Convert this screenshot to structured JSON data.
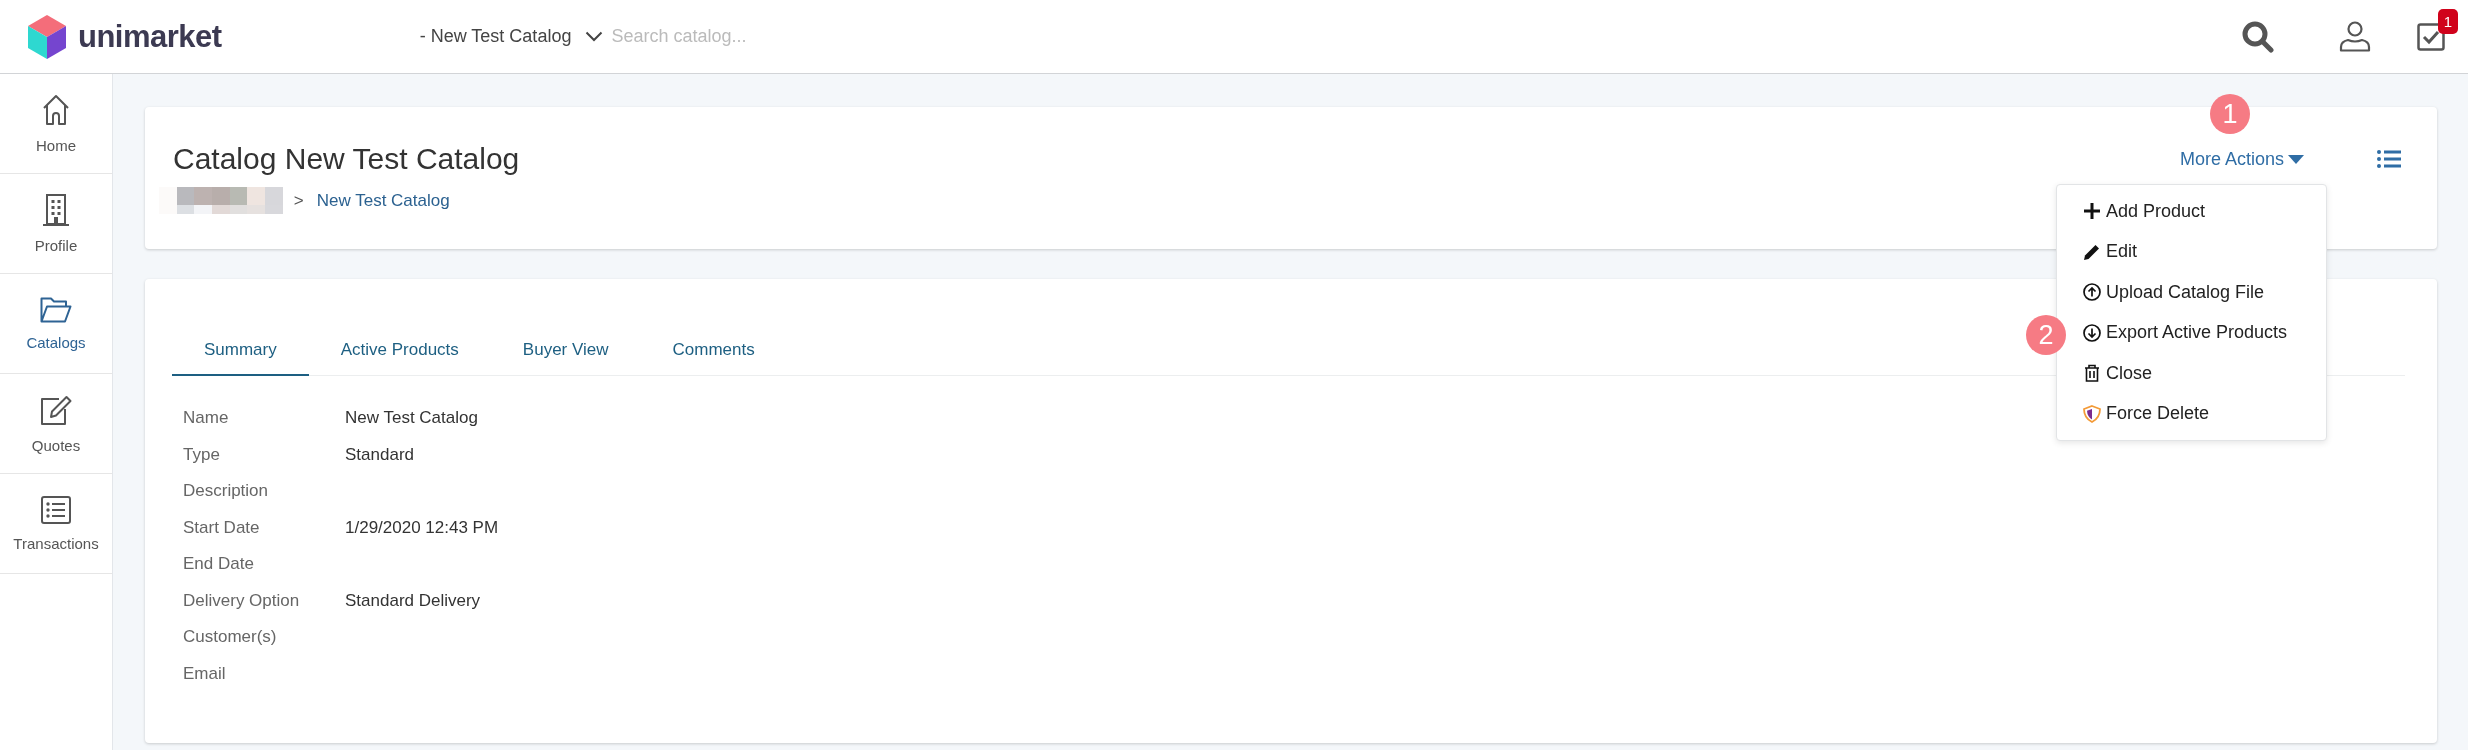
{
  "top_bar": {
    "logo_text": "unimarket",
    "catalog_selector": "- New Test Catalog",
    "search": {
      "placeholder": "Search catalog..."
    },
    "tasks_badge": "1"
  },
  "sidebar": {
    "items": [
      {
        "label": "Home",
        "selected": false
      },
      {
        "label": "Profile",
        "selected": false
      },
      {
        "label": "Catalogs",
        "selected": true
      },
      {
        "label": "Quotes",
        "selected": false
      },
      {
        "label": "Transactions",
        "selected": false
      }
    ]
  },
  "header_card": {
    "title": "Catalog New Test Catalog",
    "breadcrumb": {
      "separator": ">",
      "current": "New Test Catalog"
    },
    "more_actions": {
      "label": "More Actions",
      "expanded": true,
      "items": [
        {
          "label": "Add Product"
        },
        {
          "label": "Edit"
        },
        {
          "label": "Upload Catalog File"
        },
        {
          "label": "Export Active Products"
        },
        {
          "label": "Close"
        },
        {
          "label": "Force Delete"
        }
      ]
    }
  },
  "tabs": [
    {
      "label": "Summary",
      "selected": true
    },
    {
      "label": "Active Products",
      "selected": false
    },
    {
      "label": "Buyer View",
      "selected": false
    },
    {
      "label": "Comments",
      "selected": false
    }
  ],
  "details": [
    {
      "label": "Name",
      "value": "New Test Catalog"
    },
    {
      "label": "Type",
      "value": "Standard"
    },
    {
      "label": "Description"
    },
    {
      "label": "Start Date",
      "value": "1/29/2020 12:43 PM"
    },
    {
      "label": "End Date"
    },
    {
      "label": "Delivery Option",
      "value": "Standard Delivery"
    },
    {
      "label": "Customer(s)"
    },
    {
      "label": "Email"
    }
  ],
  "annotations": [
    {
      "number": "1"
    },
    {
      "number": "2"
    }
  ]
}
